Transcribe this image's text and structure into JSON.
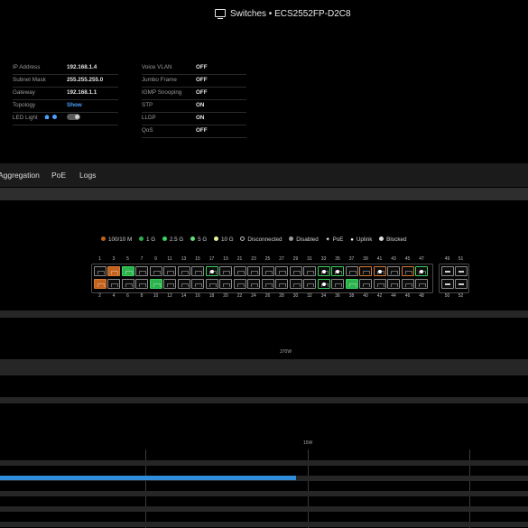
{
  "header": {
    "title": "Switches • ECS2552FP-D2C8",
    "icon": "monitor-icon"
  },
  "info_left": [
    {
      "key": "IP Address",
      "value": "192.168.1.4"
    },
    {
      "key": "Subnet Mask",
      "value": "255.255.255.0"
    },
    {
      "key": "Gateway",
      "value": "192.168.1.1"
    },
    {
      "key": "Topology",
      "value": "Show"
    },
    {
      "key": "LED Light",
      "value": ""
    }
  ],
  "info_right": [
    {
      "key": "Voice VLAN",
      "value": "OFF"
    },
    {
      "key": "Jumbo Frame",
      "value": "OFF"
    },
    {
      "key": "IGMP Snooping",
      "value": "OFF"
    },
    {
      "key": "STP",
      "value": "ON"
    },
    {
      "key": "LLDP",
      "value": "ON"
    },
    {
      "key": "QoS",
      "value": "OFF"
    }
  ],
  "tabs": [
    "Aggregation",
    "PoE",
    "Logs"
  ],
  "legend": [
    {
      "label": "100/10 M",
      "color": "#c2621d"
    },
    {
      "label": "1 G",
      "color": "#2bb24c"
    },
    {
      "label": "2.5 G",
      "color": "#3dd160"
    },
    {
      "label": "5 G",
      "color": "#5fe07a"
    },
    {
      "label": "10 G",
      "color": "#e8f0a0"
    },
    {
      "label": "Disconnected",
      "color": "#000000"
    },
    {
      "label": "Disabled",
      "color": "#9a9a9a"
    },
    {
      "label": "PoE",
      "color": "#ffffff"
    },
    {
      "label": "Uplink",
      "color": "#ffffff"
    },
    {
      "label": "Blocked",
      "color": "#ffffff"
    }
  ],
  "ports": {
    "top_numbers": [
      "1",
      "3",
      "5",
      "7",
      "9",
      "11",
      "13",
      "15",
      "17",
      "19",
      "21",
      "23",
      "25",
      "27",
      "29",
      "31",
      "33",
      "35",
      "37",
      "39",
      "41",
      "43",
      "45",
      "47"
    ],
    "bottom_numbers": [
      "2",
      "4",
      "6",
      "8",
      "10",
      "12",
      "14",
      "16",
      "18",
      "20",
      "22",
      "24",
      "26",
      "28",
      "30",
      "32",
      "34",
      "36",
      "38",
      "40",
      "42",
      "44",
      "46",
      "48"
    ],
    "sfp_top": [
      "49",
      "51"
    ],
    "sfp_bottom": [
      "50",
      "52"
    ]
  },
  "poe": {
    "budget_label": "370W",
    "scale_label": "15W",
    "usage_fraction": 0.56
  }
}
